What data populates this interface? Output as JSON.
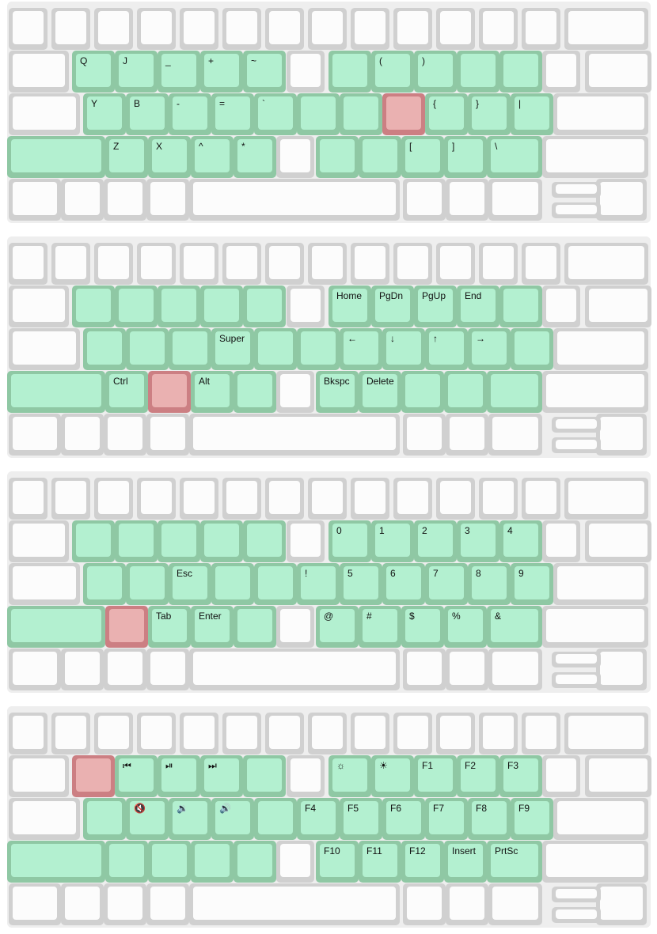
{
  "colors": {
    "board": "#eeeeee",
    "key_blank": "#fcfcfc",
    "key_active": "#b3f0d0",
    "key_held": "#eab1b1"
  },
  "layers": [
    {
      "held_key": "row2-key8",
      "labels": {
        "row1-key1": "Q",
        "row1-key2": "J",
        "row1-key3": "_",
        "row1-key4": "+",
        "row1-key5": "~",
        "row1-key7": "(",
        "row1-key8": ")",
        "row2-key1": "Y",
        "row2-key2": "B",
        "row2-key3": "-",
        "row2-key4": "=",
        "row2-key5": "`",
        "row2-key9": "{",
        "row2-key10": "}",
        "row2-key11": "|",
        "row3-key1": "Z",
        "row3-key2": "X",
        "row3-key3": "^",
        "row3-key4": "*",
        "row3-key8": "[",
        "row3-key9": "]",
        "row3-key10": "\\"
      }
    },
    {
      "held_key": "row3-key2",
      "labels": {
        "row1-key6": "Home",
        "row1-key7": "PgDn",
        "row1-key8": "PgUp",
        "row1-key9": "End",
        "row2-key4": "Super",
        "row2-key7": "←",
        "row2-key8": "↓",
        "row2-key9": "↑",
        "row2-key10": "→",
        "row3-key1": "Ctrl",
        "row3-key3": "Alt",
        "row3-key6": "Bkspc",
        "row3-key7": "Delete"
      }
    },
    {
      "held_key": "row3-key1",
      "labels": {
        "row1-key6": "0",
        "row1-key7": "1",
        "row1-key8": "2",
        "row1-key9": "3",
        "row1-key10": "4",
        "row2-key3": "Esc",
        "row2-key6": "!",
        "row2-key7": "5",
        "row2-key8": "6",
        "row2-key9": "7",
        "row2-key10": "8",
        "row2-key11": "9",
        "row3-key2": "Tab",
        "row3-key3": "Enter",
        "row3-key6": "@",
        "row3-key7": "#",
        "row3-key8": "$",
        "row3-key9": "%",
        "row3-key10": "&"
      }
    },
    {
      "held_key": "row1-key1",
      "labels": {
        "row1-key2": "⏮",
        "row1-key3": "⏯",
        "row1-key4": "⏭",
        "row1-key6": "☼",
        "row1-key7": "☀",
        "row1-key8": "F1",
        "row1-key9": "F2",
        "row1-key10": "F3",
        "row2-key2": "🔇",
        "row2-key3": "🔉",
        "row2-key4": "🔊",
        "row2-key6": "F4",
        "row2-key7": "F5",
        "row2-key8": "F6",
        "row2-key9": "F7",
        "row2-key10": "F8",
        "row2-key11": "F9",
        "row3-key6": "F10",
        "row3-key7": "F11",
        "row3-key8": "F12",
        "row3-key9": "Insert",
        "row3-key10": "PrtSc"
      }
    }
  ]
}
